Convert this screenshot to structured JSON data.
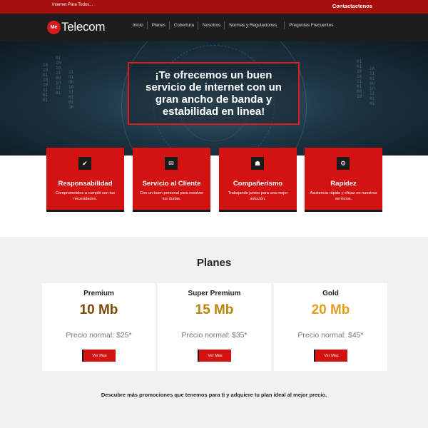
{
  "topbar": {
    "tagline": "Internet Para Todos...",
    "contact": "Contactactenos"
  },
  "logo": {
    "badge": "Me",
    "text": "Telecom"
  },
  "nav": [
    {
      "label": "Inicio"
    },
    {
      "label": "Planes"
    },
    {
      "label": "Cobertura"
    },
    {
      "label": "Nosotros"
    },
    {
      "label": "Normas y Regulaciones",
      "caret": "⌄"
    },
    {
      "label": "Preguntas Frecuentes"
    }
  ],
  "hero": {
    "text": "¡Te ofrecemos un buen servicio de internet con un gran ancho de banda y estabilidad en linea!"
  },
  "features": [
    {
      "icon": "check-icon",
      "glyph": "✔",
      "title": "Responsabilidad",
      "desc": "Comprometidos a cumplir con tus necesidades."
    },
    {
      "icon": "chat-icon",
      "glyph": "✉",
      "title": "Servicio al Cliente",
      "desc": "Con un buen personal para resolver tus dudas."
    },
    {
      "icon": "team-icon",
      "glyph": "☗",
      "title": "Compañerismo",
      "desc": "Trabajando juntos para una mejor solución."
    },
    {
      "icon": "motorcycle-icon",
      "glyph": "⚙",
      "title": "Rapidez",
      "desc": "Asistencia rápida y eficaz en nuestros servicios."
    }
  ],
  "plans": {
    "title": "Planes",
    "items": [
      {
        "name": "Premium",
        "speed": "10 Mb",
        "color": "#7a4a08",
        "price": "Precio normal: $25*",
        "button": "Ver Mas"
      },
      {
        "name": "Super Premium",
        "speed": "15 Mb",
        "color": "#b8860b",
        "price": "Precio normal: $35*",
        "button": "Ver Mas"
      },
      {
        "name": "Gold",
        "speed": "20 Mb",
        "color": "#e0a020",
        "price": "Precio normal: $45*",
        "button": "Ver Mas"
      }
    ],
    "promo": "Descubre más promociones que tenemos para ti y adquiere tu plan ideal al mejor precio."
  },
  "colors": {
    "brand": "#d31212",
    "topbar": "#a80d0d",
    "nav": "#1d1d1d"
  }
}
